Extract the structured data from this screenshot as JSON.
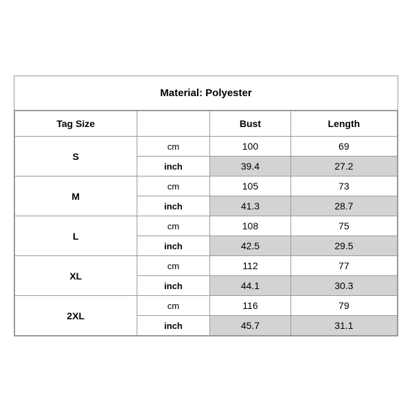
{
  "title": "Material: Polyester",
  "headers": {
    "tag_size": "Tag Size",
    "bust": "Bust",
    "length": "Length"
  },
  "sizes": [
    {
      "tag": "S",
      "cm": {
        "bust": "100",
        "length": "69"
      },
      "inch": {
        "bust": "39.4",
        "length": "27.2"
      }
    },
    {
      "tag": "M",
      "cm": {
        "bust": "105",
        "length": "73"
      },
      "inch": {
        "bust": "41.3",
        "length": "28.7"
      }
    },
    {
      "tag": "L",
      "cm": {
        "bust": "108",
        "length": "75"
      },
      "inch": {
        "bust": "42.5",
        "length": "29.5"
      }
    },
    {
      "tag": "XL",
      "cm": {
        "bust": "112",
        "length": "77"
      },
      "inch": {
        "bust": "44.1",
        "length": "30.3"
      }
    },
    {
      "tag": "2XL",
      "cm": {
        "bust": "116",
        "length": "79"
      },
      "inch": {
        "bust": "45.7",
        "length": "31.1"
      }
    }
  ],
  "units": {
    "cm": "cm",
    "inch": "inch"
  }
}
